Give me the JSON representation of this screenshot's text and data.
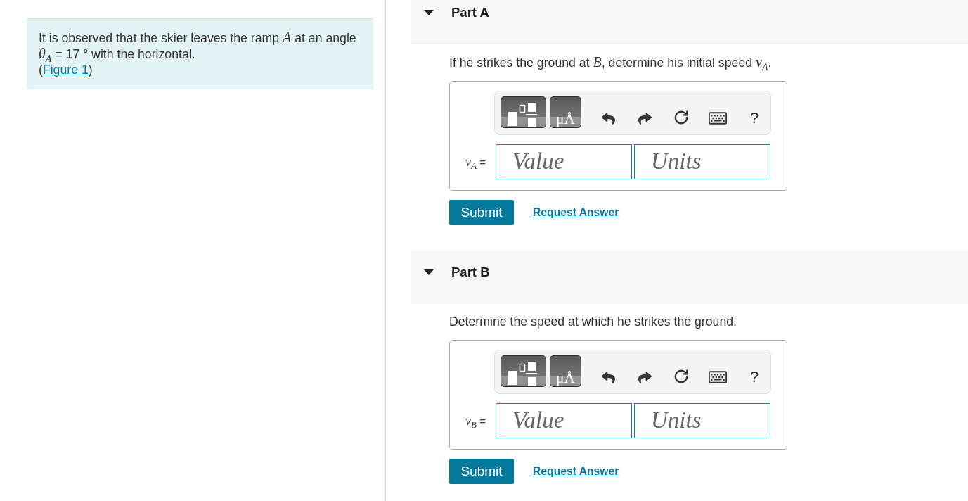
{
  "intro": {
    "text": "It is observed that the skier leaves the ramp *A* at an angle *θ*$_{A}$ = 17 ° with the horizontal.",
    "figure_ref": {
      "open": "(",
      "link": "Figure 1",
      "close": ")"
    }
  },
  "parts": [
    {
      "title": "Part A",
      "expanded": true,
      "question": "If he strikes the ground at *B*, determine his initial speed *v*$_{A}$.",
      "toolbar": {
        "units_button": "μÅ",
        "help": "?"
      },
      "answer_label": "*v*$_{A}$ =",
      "value_placeholder": "Value",
      "units_placeholder": "Units",
      "submit": "Submit",
      "request": "Request Answer"
    },
    {
      "title": "Part B",
      "expanded": true,
      "question": "Determine the speed at which he strikes the ground.",
      "toolbar": {
        "units_button": "μÅ",
        "help": "?"
      },
      "answer_label": "*v*$_{B}$ =",
      "value_placeholder": "Value",
      "units_placeholder": "Units",
      "submit": "Submit",
      "request": "Request Answer"
    }
  ]
}
